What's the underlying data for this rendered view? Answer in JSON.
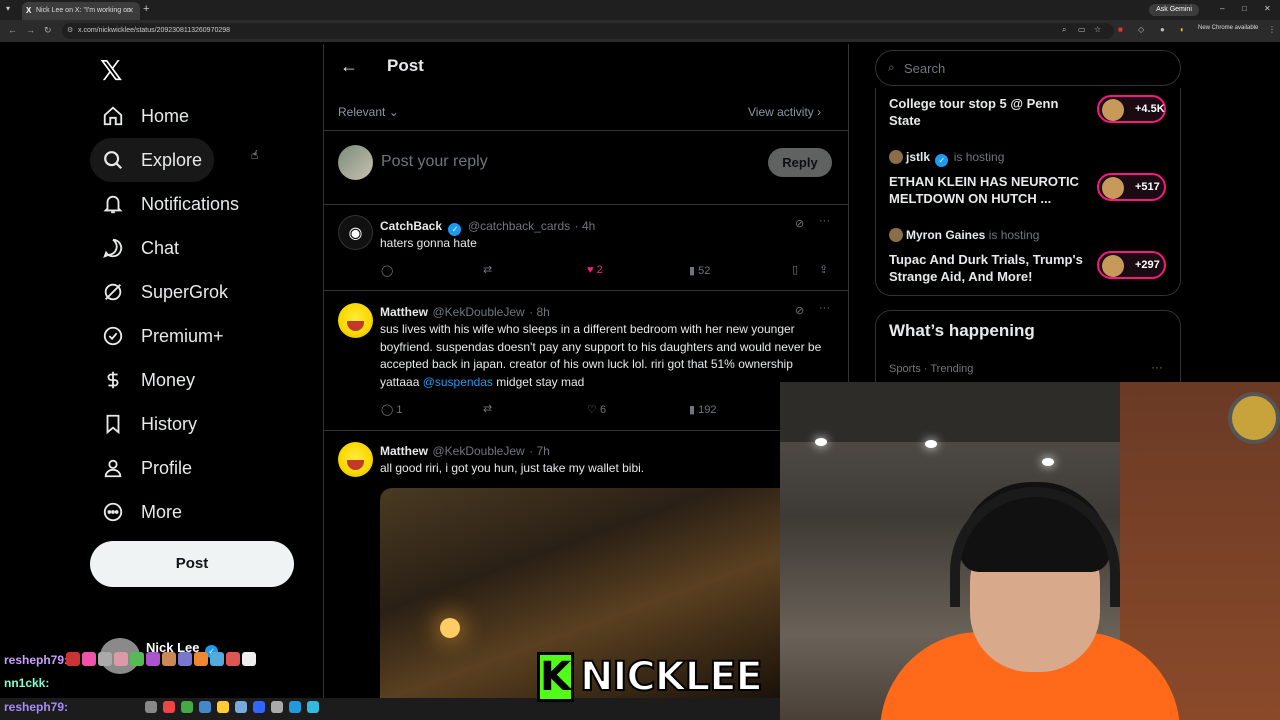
{
  "browser": {
    "tab_title": "Nick Lee on X: \"I'm working on",
    "url": "x.com/nickwicklee/status/2092308113260970298",
    "ask_gemini": "Ask Gemini",
    "update_badge": "New Chrome available"
  },
  "nav": {
    "items": [
      {
        "label": "Home",
        "icon": "home-icon"
      },
      {
        "label": "Explore",
        "icon": "search-icon"
      },
      {
        "label": "Notifications",
        "icon": "bell-icon"
      },
      {
        "label": "Chat",
        "icon": "chat-icon"
      },
      {
        "label": "SuperGrok",
        "icon": "grok-icon"
      },
      {
        "label": "Premium+",
        "icon": "verified-icon"
      },
      {
        "label": "Money",
        "icon": "money-icon"
      },
      {
        "label": "History",
        "icon": "bookmark-icon"
      },
      {
        "label": "Profile",
        "icon": "person-icon"
      },
      {
        "label": "More",
        "icon": "more-icon"
      }
    ],
    "post_button": "Post"
  },
  "post": {
    "title": "Post",
    "sort": "Relevant",
    "view_activity": "View activity",
    "reply_placeholder": "Post your reply",
    "reply_button": "Reply"
  },
  "replies": [
    {
      "name": "CatchBack",
      "handle": "@catchback_cards",
      "time": "· 4h",
      "text": "haters gonna hate",
      "likes": "2",
      "views": "52"
    },
    {
      "name": "Matthew",
      "handle": "@KekDoubleJew",
      "time": "· 8h",
      "text_before": "sus lives with his wife who sleeps in a different bedroom with her new younger boyfriend. suspendas doesn't pay any support to his daughters and would never be accepted back in japan. creator of his own luck lol. riri got that 51% ownership yattaaa ",
      "mention": "@suspendas",
      "text_after": " midget stay mad",
      "replies": "1",
      "likes": "6",
      "views": "192"
    },
    {
      "name": "Matthew",
      "handle": "@KekDoubleJew",
      "time": "· 7h",
      "text": "all good riri, i got you hun, just take my wallet bibi."
    }
  ],
  "sidebar": {
    "search_placeholder": "Search",
    "spaces": [
      {
        "title": "College tour stop 5 @ Penn State",
        "count": "+4.5K"
      },
      {
        "host": "jstlk",
        "host_suffix": "is hosting",
        "title": "ETHAN KLEIN HAS NEUROTIC MELTDOWN ON HUTCH ...",
        "count": "+517"
      },
      {
        "host": "Myron Gaines",
        "host_suffix": "is hosting",
        "title": "Tupac And Durk Trials, Trump's Strange Aid, And More!",
        "count": "+297"
      }
    ],
    "happening_title": "What’s happening",
    "trend_meta": "Sports · Trending"
  },
  "stream": {
    "chat_user1": "resheph79:",
    "chat_user2": "nn1ckk:",
    "chat_user3": "resheph79:",
    "account_name": "Nick Lee",
    "brand_k": "K",
    "brand_name": "NICKLEE"
  }
}
